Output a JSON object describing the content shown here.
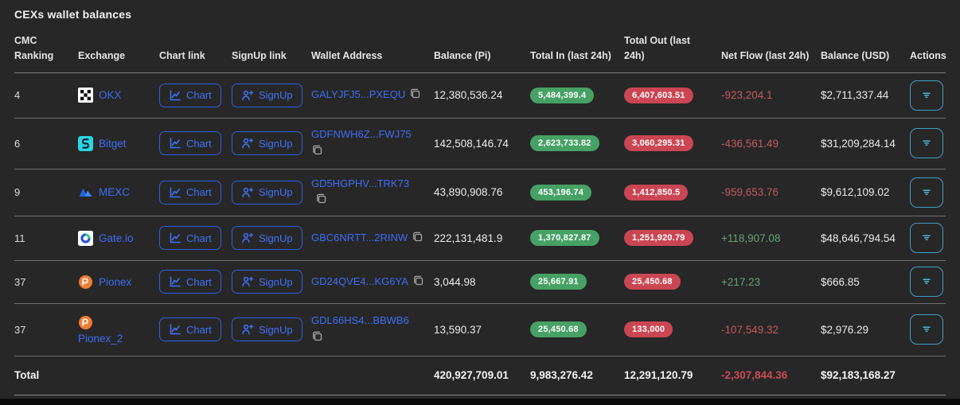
{
  "title": "CEXs wallet balances",
  "colors": {
    "background": "#272727",
    "link_blue": "#3b6ef5",
    "badge_green": "#46a164",
    "badge_red": "#ca4653",
    "flow_negative": "#c25a5f",
    "flow_positive": "#63a377",
    "action_teal": "#3f9fc4"
  },
  "table": {
    "columns": [
      "CMC Ranking",
      "Exchange",
      "Chart link",
      "SignUp link",
      "Wallet Address",
      "Balance (Pi)",
      "Total In (last 24h)",
      "Total Out (last 24h)",
      "Net Flow (last 24h)",
      "Balance (USD)",
      "Actions"
    ],
    "buttons": {
      "chart": "Chart",
      "signup": "SignUp"
    },
    "rows": [
      {
        "rank": "4",
        "exchange": "OKX",
        "wallet": "GALYJFJ5...PXEQU",
        "balance_pi": "12,380,536.24",
        "total_in": "5,484,399.4",
        "total_out": "6,407,603.51",
        "net_flow": "-923,204.1",
        "balance_usd": "$2,711,337.44"
      },
      {
        "rank": "6",
        "exchange": "Bitget",
        "wallet": "GDFNWH6Z...FWJ75",
        "balance_pi": "142,508,146.74",
        "total_in": "2,623,733.82",
        "total_out": "3,060,295.31",
        "net_flow": "-436,561.49",
        "balance_usd": "$31,209,284.14"
      },
      {
        "rank": "9",
        "exchange": "MEXC",
        "wallet": "GD5HGPHV...TRK73",
        "balance_pi": "43,890,908.76",
        "total_in": "453,196.74",
        "total_out": "1,412,850.5",
        "net_flow": "-959,653.76",
        "balance_usd": "$9,612,109.02"
      },
      {
        "rank": "11",
        "exchange": "Gate.io",
        "wallet": "GBC6NRTT...2RINW",
        "balance_pi": "222,131,481.9",
        "total_in": "1,370,827.87",
        "total_out": "1,251,920.79",
        "net_flow": "+118,907.08",
        "balance_usd": "$48,646,794.54"
      },
      {
        "rank": "37",
        "exchange": "Pionex",
        "wallet": "GD24QVE4...KG6YA",
        "balance_pi": "3,044.98",
        "total_in": "25,667.91",
        "total_out": "25,450.68",
        "net_flow": "+217.23",
        "balance_usd": "$666.85"
      },
      {
        "rank": "37",
        "exchange": "Pionex_2",
        "wallet": "GDL66HS4...BBWB6",
        "balance_pi": "13,590.37",
        "total_in": "25,450.68",
        "total_out": "133,000",
        "net_flow": "-107,549.32",
        "balance_usd": "$2,976.29"
      }
    ],
    "total": {
      "label": "Total",
      "balance_pi": "420,927,709.01",
      "total_in": "9,983,276.42",
      "total_out": "12,291,120.79",
      "net_flow": "-2,307,844.36",
      "balance_usd": "$92,183,168.27"
    }
  }
}
